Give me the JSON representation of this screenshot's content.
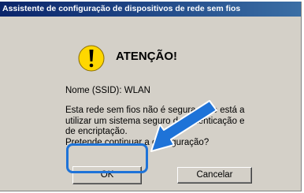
{
  "window": {
    "title": "Assistente de configuração de dispositivos de rede sem fios"
  },
  "dialog": {
    "heading": "ATENÇÃO!",
    "ssid_line": "Nome (SSID): WLAN",
    "message_lines": [
      "Esta rede sem fios não é segura. Não está a",
      "utilizar um sistema seguro de autenticação e",
      "de encriptação.",
      "Pretende continuar a configuração?"
    ]
  },
  "buttons": {
    "ok_label": "OK",
    "cancel_label": "Cancelar"
  },
  "icons": {
    "warning": "warning-icon",
    "pointer": "arrow-pointer-icon"
  },
  "colors": {
    "title_bar": "#0a246a",
    "dialog_bg": "#d4d0c8",
    "highlight": "#1e73d8",
    "warning_fill": "#ffd700"
  }
}
